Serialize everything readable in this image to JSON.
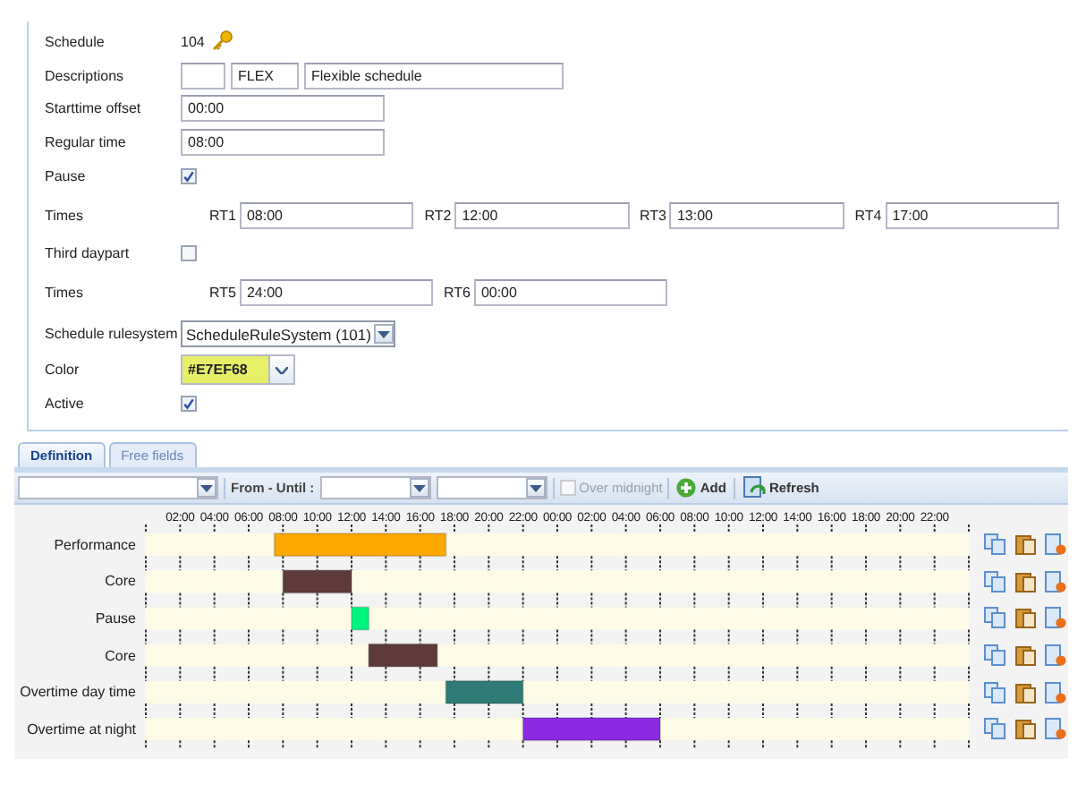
{
  "form": {
    "rows": [
      {
        "kind": "id",
        "label": "Schedule",
        "value": "104"
      },
      {
        "kind": "descriptions",
        "label": "Descriptions",
        "fields": [
          {
            "kind": "blank"
          },
          {
            "kind": "text",
            "value": "FLEX"
          },
          {
            "kind": "text",
            "value": "Flexible schedule"
          }
        ]
      },
      {
        "kind": "text",
        "label": "Starttime offset",
        "value": "00:00"
      },
      {
        "kind": "text",
        "label": "Regular time",
        "value": "08:00"
      },
      {
        "kind": "checkbox",
        "label": "Pause",
        "checked": true
      },
      {
        "kind": "times",
        "label": "Times",
        "slots": [
          {
            "label": "RT1",
            "value": "08:00"
          },
          {
            "label": "RT2",
            "value": "12:00"
          },
          {
            "label": "RT3",
            "value": "13:00"
          },
          {
            "label": "RT4",
            "value": "17:00"
          }
        ]
      },
      {
        "kind": "checkbox",
        "label": "Third daypart",
        "checked": false
      },
      {
        "kind": "times",
        "label": "Times",
        "slots": [
          {
            "label": "RT5",
            "value": "24:00"
          },
          {
            "label": "RT6",
            "value": "00:00"
          }
        ]
      },
      {
        "kind": "select",
        "label": "Schedule rulesystem",
        "value": "ScheduleRuleSystem (101)"
      },
      {
        "kind": "color",
        "label": "Color",
        "value": "#E7EF68",
        "color": "#e7ef68"
      },
      {
        "kind": "checkbox",
        "label": "Active",
        "checked": true
      }
    ]
  },
  "tabs": [
    {
      "label": "Definition",
      "selected": true
    },
    {
      "label": "Free fields",
      "selected": false
    }
  ],
  "toolbar": {
    "from_until_label": "From - Until :",
    "over_midnight": {
      "label": "Over midnight",
      "checked": false,
      "disabled": true
    },
    "add_button": "Add",
    "refresh_button": "Refresh"
  },
  "timeline": {
    "hours": [
      "02:00",
      "04:00",
      "06:00",
      "08:00",
      "10:00",
      "12:00",
      "14:00",
      "16:00",
      "18:00",
      "20:00",
      "22:00",
      "00:00",
      "02:00",
      "04:00",
      "06:00",
      "08:00",
      "10:00",
      "12:00",
      "14:00",
      "16:00",
      "18:00",
      "20:00",
      "22:00"
    ],
    "rows": [
      {
        "label": "Performance",
        "color": "#ffa800"
      },
      {
        "label": "Core",
        "color": "#5e3b3b"
      },
      {
        "label": "Pause",
        "color": "#00f57f"
      },
      {
        "label": "Core",
        "color": "#5e3b3b"
      },
      {
        "label": "Overtime day time",
        "color": "#2e7b77"
      },
      {
        "label": "Overtime at night",
        "color": "#8a2be2"
      }
    ]
  }
}
